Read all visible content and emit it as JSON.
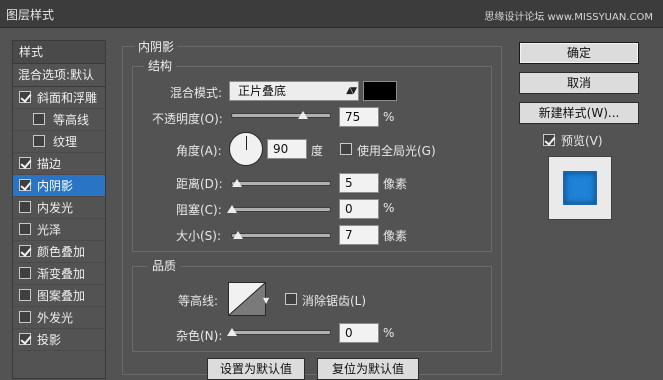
{
  "window": {
    "title": "图层样式",
    "watermark": "思缘设计论坛 www.MISSYUAN.COM"
  },
  "styles_panel": {
    "header": "样式",
    "blend_options": "混合选项:默认",
    "items": [
      {
        "label": "斜面和浮雕",
        "checked": true,
        "selected": false,
        "indent": false
      },
      {
        "label": "等高线",
        "checked": false,
        "selected": false,
        "indent": true
      },
      {
        "label": "纹理",
        "checked": false,
        "selected": false,
        "indent": true
      },
      {
        "label": "描边",
        "checked": true,
        "selected": false,
        "indent": false
      },
      {
        "label": "内阴影",
        "checked": true,
        "selected": true,
        "indent": false
      },
      {
        "label": "内发光",
        "checked": false,
        "selected": false,
        "indent": false
      },
      {
        "label": "光泽",
        "checked": false,
        "selected": false,
        "indent": false
      },
      {
        "label": "颜色叠加",
        "checked": true,
        "selected": false,
        "indent": false
      },
      {
        "label": "渐变叠加",
        "checked": false,
        "selected": false,
        "indent": false
      },
      {
        "label": "图案叠加",
        "checked": false,
        "selected": false,
        "indent": false
      },
      {
        "label": "外发光",
        "checked": false,
        "selected": false,
        "indent": false
      },
      {
        "label": "投影",
        "checked": true,
        "selected": false,
        "indent": false
      }
    ]
  },
  "inner_shadow": {
    "title": "内阴影",
    "structure": {
      "title": "结构",
      "blend_mode_label": "混合模式:",
      "blend_mode_value": "正片叠底",
      "shadow_color": "#000000",
      "opacity_label": "不透明度(O):",
      "opacity_value": "75",
      "opacity_unit": "%",
      "angle_label": "角度(A):",
      "angle_value": "90",
      "angle_unit": "度",
      "global_light_label": "使用全局光(G)",
      "global_light_checked": false,
      "distance_label": "距离(D):",
      "distance_value": "5",
      "distance_unit": "像素",
      "choke_label": "阻塞(C):",
      "choke_value": "0",
      "choke_unit": "%",
      "size_label": "大小(S):",
      "size_value": "7",
      "size_unit": "像素"
    },
    "quality": {
      "title": "品质",
      "contour_label": "等高线:",
      "anti_alias_label": "消除锯齿(L)",
      "anti_alias_checked": false,
      "noise_label": "杂色(N):",
      "noise_value": "0",
      "noise_unit": "%"
    },
    "set_default": "设置为默认值",
    "reset_default": "复位为默认值"
  },
  "actions": {
    "ok": "确定",
    "cancel": "取消",
    "new_style": "新建样式(W)...",
    "preview_label": "预览(V)",
    "preview_checked": true,
    "preview_color": "#1e82d6"
  }
}
